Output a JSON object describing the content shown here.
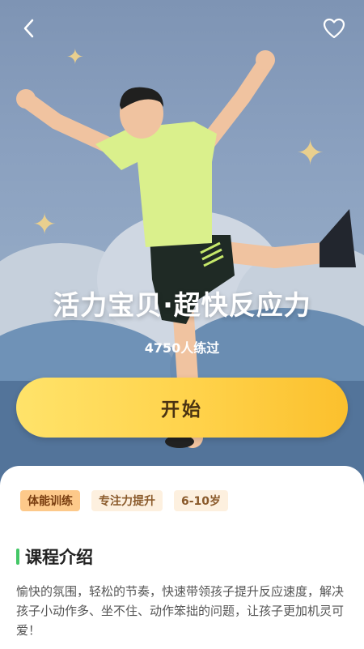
{
  "header": {
    "back_icon": "chevron-left-icon",
    "favorite_icon": "heart-outline-icon"
  },
  "hero": {
    "title": "活力宝贝·超快反应力",
    "practice_count": "4750人练过",
    "start_label": "开始",
    "button_color": "#ffd24a"
  },
  "tags": [
    {
      "label": "体能训练",
      "active": true
    },
    {
      "label": "专注力提升",
      "active": false
    },
    {
      "label": "6-10岁",
      "active": false
    }
  ],
  "section": {
    "title": "课程介绍",
    "accent_color": "#44c767",
    "description": "愉快的氛围，轻松的节奏，快速带领孩子提升反应速度，解决孩子小动作多、坐不住、动作笨拙的问题，让孩子更加机灵可爱！"
  }
}
